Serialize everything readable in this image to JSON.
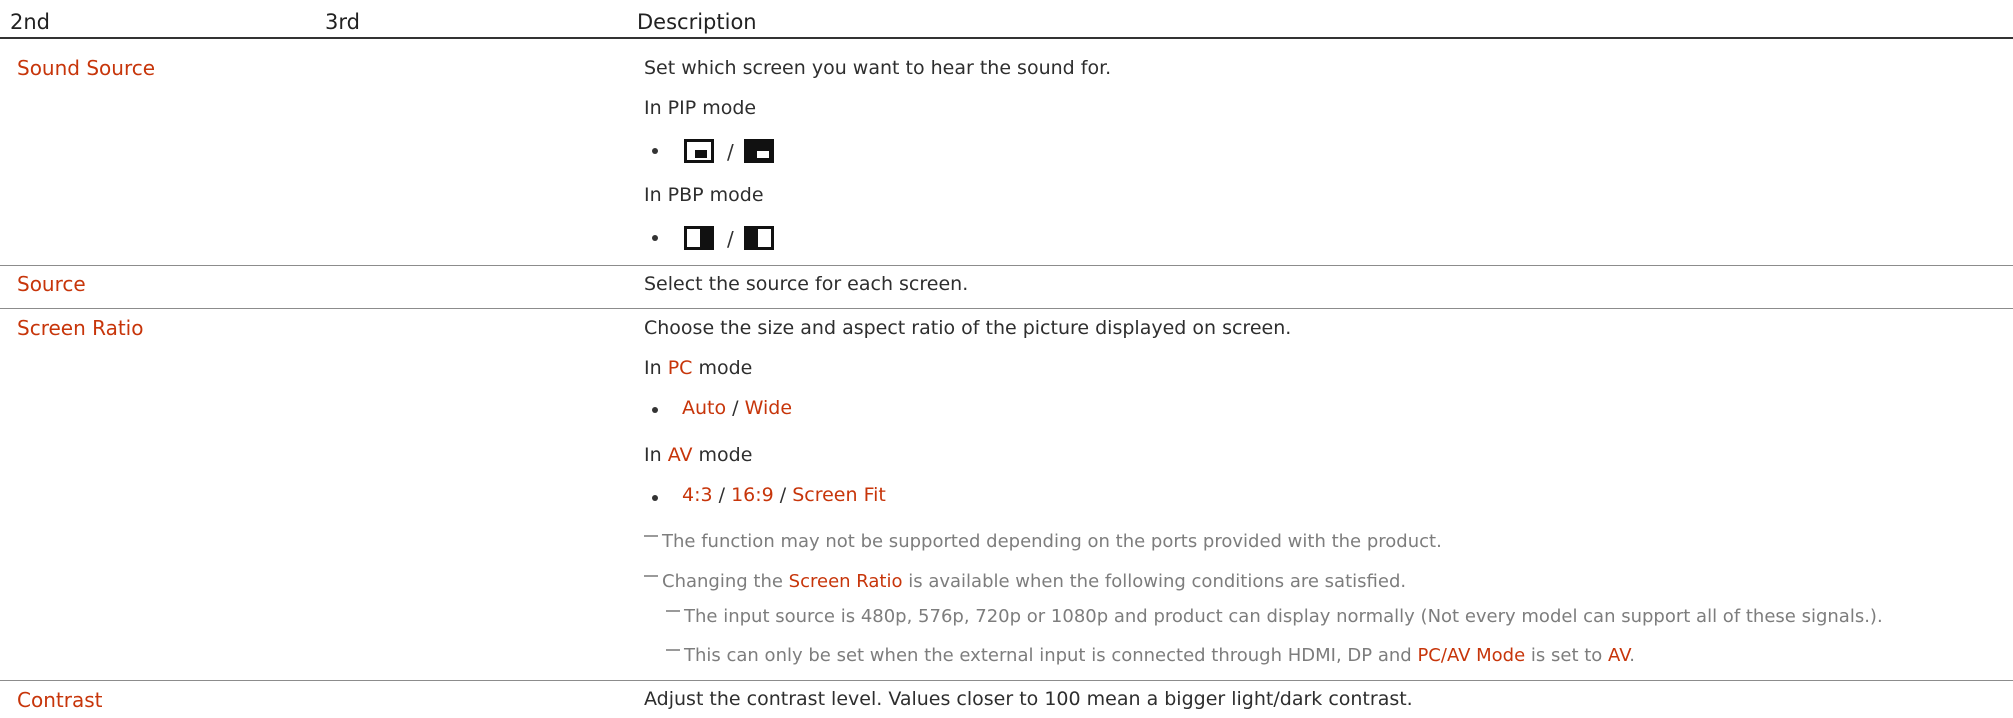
{
  "table": {
    "headers": {
      "col_2nd": "2nd",
      "col_3rd": "3rd",
      "col_description": "Description"
    }
  },
  "rows": {
    "sound_source": {
      "label": "Sound Source",
      "description": "Set which screen you want to hear the sound for.",
      "pip_mode": "In PIP mode",
      "pbp_mode": "In PBP mode",
      "separator": "/"
    },
    "source": {
      "label": "Source",
      "description": "Select the source for each screen."
    },
    "screen_ratio": {
      "label": "Screen Ratio",
      "description": "Choose the size and aspect ratio of the picture displayed on screen.",
      "pc_mode_prefix": "In ",
      "pc_mode_term": "PC",
      "pc_mode_suffix": " mode",
      "pc_options": [
        "Auto",
        "Wide"
      ],
      "av_mode_prefix": "In ",
      "av_mode_term": "AV",
      "av_mode_suffix": " mode",
      "av_options": [
        "4:3",
        "16:9",
        "Screen Fit"
      ],
      "separator": " / ",
      "note1": "The function may not be supported depending on the ports provided with the product.",
      "note2_prefix": "Changing the ",
      "note2_term": "Screen Ratio",
      "note2_suffix": " is available when the following conditions are satisfied.",
      "subnote1": "The input source is 480p, 576p, 720p or 1080p and product can display normally (Not every model can support all of these signals.).",
      "subnote2_prefix": "This can only be set when the external input is connected through HDMI, DP and ",
      "subnote2_term1": "PC/AV Mode",
      "subnote2_mid": " is set to ",
      "subnote2_term2": "AV",
      "subnote2_suffix": "."
    },
    "contrast": {
      "label": "Contrast",
      "description": "Adjust the contrast level. Values closer to 100 mean a bigger light/dark contrast."
    }
  },
  "colors": {
    "accent": "#c7350a",
    "text": "#2e2e2e",
    "note": "#7d7d7d",
    "rule": "#8c8c8c"
  },
  "icons": [
    "pip-small-icon",
    "pip-large-icon",
    "pbp-left-icon",
    "pbp-right-icon"
  ]
}
